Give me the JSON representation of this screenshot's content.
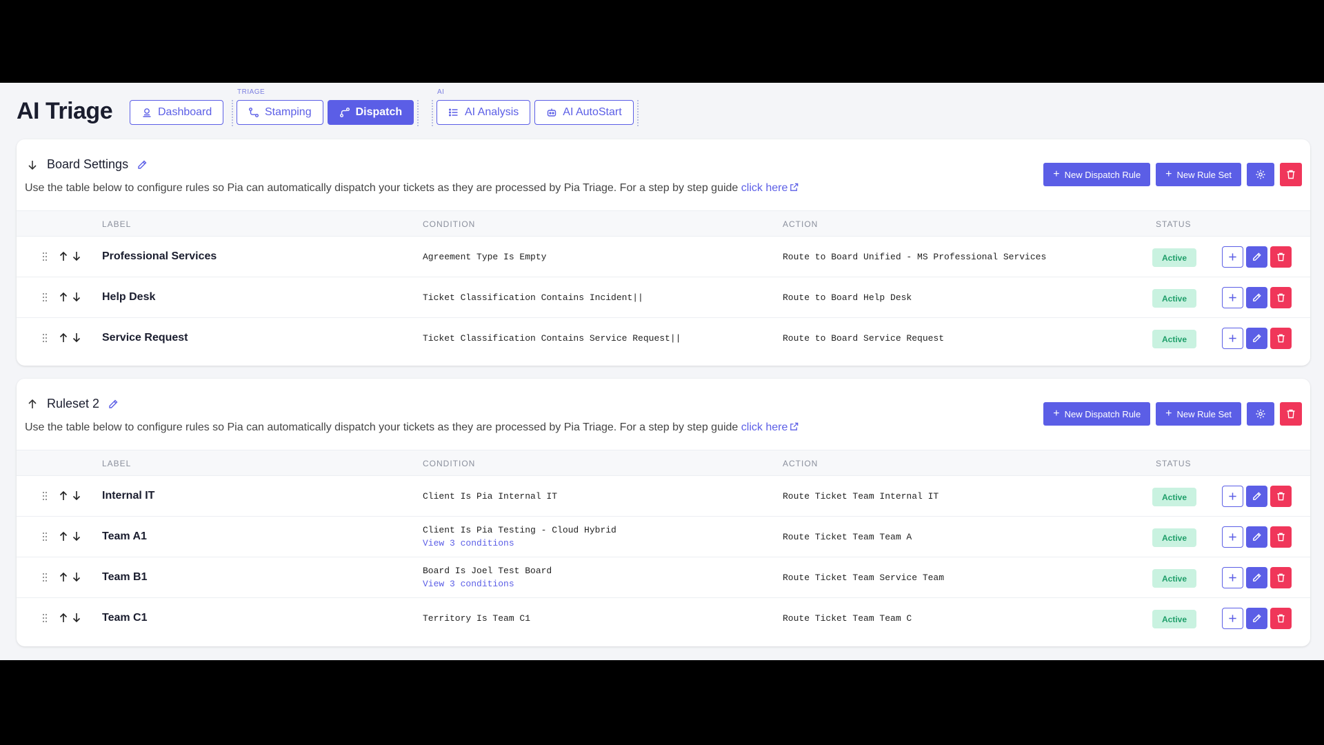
{
  "header": {
    "title": "AI Triage",
    "nav_dashboard": "Dashboard",
    "group_triage": "TRIAGE",
    "nav_stamping": "Stamping",
    "nav_dispatch": "Dispatch",
    "group_ai": "AI",
    "nav_ai_analysis": "AI Analysis",
    "nav_ai_autostart": "AI AutoStart"
  },
  "columns": {
    "label": "LABEL",
    "condition": "CONDITION",
    "action": "ACTION",
    "status": "STATUS"
  },
  "buttons": {
    "new_dispatch_rule": "New Dispatch Rule",
    "new_rule_set": "New Rule Set"
  },
  "rulesets": [
    {
      "title": "Board Settings",
      "description": "Use the table below to configure rules so Pia can automatically dispatch your tickets as they are processed by Pia Triage. For a step by step guide ",
      "link_text": "click here",
      "rows": [
        {
          "label": "Professional Services",
          "condition": "Agreement Type Is Empty",
          "condition_more": "",
          "action": "Route to Board Unified - MS Professional Services",
          "status": "Active"
        },
        {
          "label": "Help Desk",
          "condition": "Ticket Classification Contains Incident||",
          "condition_more": "",
          "action": "Route to Board Help Desk",
          "status": "Active"
        },
        {
          "label": "Service Request",
          "condition": "Ticket Classification Contains Service Request||",
          "condition_more": "",
          "action": "Route to Board Service Request",
          "status": "Active"
        }
      ]
    },
    {
      "title": "Ruleset 2",
      "description": "Use the table below to configure rules so Pia can automatically dispatch your tickets as they are processed by Pia Triage. For a step by step guide ",
      "link_text": "click here",
      "rows": [
        {
          "label": "Internal IT",
          "condition": "Client Is Pia Internal IT",
          "condition_more": "",
          "action": "Route Ticket Team Internal IT",
          "status": "Active"
        },
        {
          "label": "Team A1",
          "condition": "Client Is Pia Testing - Cloud Hybrid",
          "condition_more": "View 3 conditions",
          "action": "Route Ticket Team Team A",
          "status": "Active"
        },
        {
          "label": "Team B1",
          "condition": "Board Is Joel Test Board",
          "condition_more": "View 3 conditions",
          "action": "Route Ticket Team Service Team",
          "status": "Active"
        },
        {
          "label": "Team C1",
          "condition": "Territory Is Team C1",
          "condition_more": "",
          "action": "Route Ticket Team Team C",
          "status": "Active"
        }
      ]
    }
  ],
  "colors": {
    "accent": "#5b5ee6",
    "danger": "#f0365a",
    "active_bg": "#c9f2e0",
    "active_text": "#1e9e69"
  }
}
